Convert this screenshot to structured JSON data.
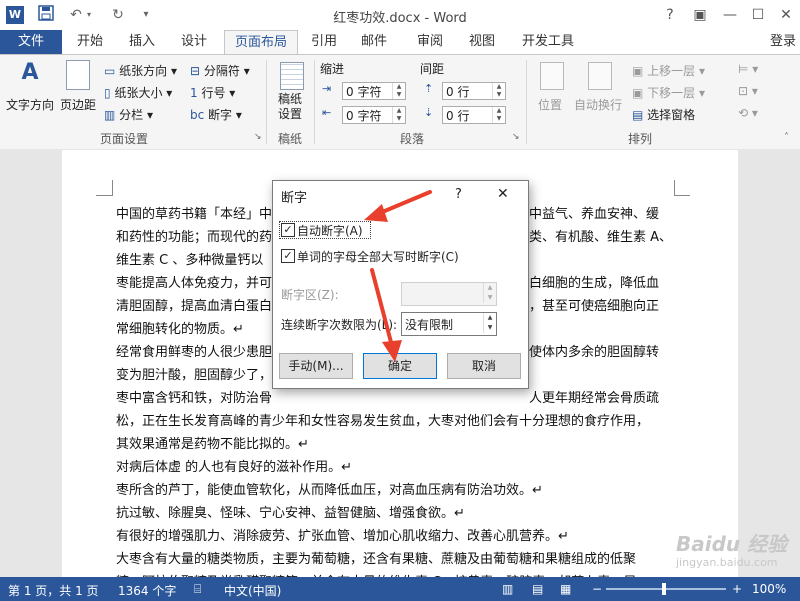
{
  "window": {
    "title": "红枣功效.docx - Word",
    "login": "登录"
  },
  "tabs": [
    {
      "label": "文件"
    },
    {
      "label": "开始"
    },
    {
      "label": "插入"
    },
    {
      "label": "设计"
    },
    {
      "label": "页面布局"
    },
    {
      "label": "引用"
    },
    {
      "label": "邮件"
    },
    {
      "label": "审阅"
    },
    {
      "label": "视图"
    },
    {
      "label": "开发工具"
    }
  ],
  "ribbon": {
    "page_setup": {
      "group_label": "页面设置",
      "text_direction": "文字方向",
      "margins": "页边距",
      "orientation": "纸张方向",
      "size": "纸张大小",
      "columns": "分栏",
      "breaks": "分隔符",
      "line_numbers": "行号",
      "hyphenation": "断字"
    },
    "draft": {
      "group_label": "稿纸",
      "draft_setup": "稿纸\n设置"
    },
    "paragraph": {
      "group_label": "段落",
      "indent_label": "缩进",
      "spacing_label": "间距",
      "indent_left": "0 字符",
      "indent_right": "0 字符",
      "spacing_before": "0 行",
      "spacing_after": "0 行"
    },
    "arrange": {
      "group_label": "排列",
      "position": "位置",
      "wrap_text": "自动换行",
      "bring_forward": "上移一层",
      "send_backward": "下移一层",
      "selection_pane": "选择窗格"
    }
  },
  "document": {
    "lines": [
      "中国的草药书籍「本经」中",
      "和药性的功能；而现代的药",
      "维生素 C 、多种微量钙以",
      "枣能提高人体免疫力，并可",
      "清胆固醇，提高血清白蛋白",
      "常细胞转化的物质。↵",
      "经常食用鲜枣的人很少患胆",
      "变为胆汁酸，胆固醇少了，",
      "枣中富含钙和铁，对防治骨",
      "松，正在生长发育高峰的青少年和女性容易发生贫血，大枣对他们会有十分理想的食疗作用，",
      "其效果通常是药物不能比拟的。↵",
      "对病后体虚 的人也有良好的滋补作用。↵",
      "枣所含的芦丁，能使血管软化，从而降低血压，对高血压病有防治功效。↵",
      "抗过敏、除腥臭、怪味、宁心安神、益智健脑、增强食欲。↵",
      "有很好的增强肌力、消除疲劳、扩张血管、增加心肌收缩力、改善心肌营养。↵",
      "大枣含有大量的糖类物质，主要为葡萄糖，还含有果糖、蔗糖及由葡萄糖和果糖组成的低聚",
      "糖、阿拉伯聚糖及半乳醛聚糖等；并含有大量的维生素 C、核黄素、硫胺素、胡萝卜素、尼"
    ],
    "right_fragments": [
      "中益气、养血安神、缓",
      "类、有机酸、维生素 A、",
      "白细胞的生成，降低血",
      "，甚至可使癌细胞向正",
      "使体内多余的胆固醇转",
      "人更年期经常会骨质疏"
    ]
  },
  "dialog": {
    "title": "断字",
    "help": "?",
    "close": "✕",
    "auto_hyphenate": {
      "label": "自动断字(A)",
      "checked": true
    },
    "caps_hyphenate": {
      "label": "单词的字母全部大写时断字(C)",
      "checked": true
    },
    "zone_label": "断字区(Z):",
    "zone_value": "",
    "limit_label": "连续断字次数限为(L):",
    "limit_value": "没有限制",
    "manual_button": "手动(M)...",
    "ok_button": "确定",
    "cancel_button": "取消"
  },
  "status": {
    "page": "第 1 页，共 1 页",
    "words": "1364 个字",
    "language": "中文(中国)",
    "zoom": "100%",
    "watermark": "Baidu 经验",
    "watermark_url": "jingyan.baidu.com"
  },
  "colors": {
    "accent": "#2b579a",
    "arrow": "#e8402c"
  }
}
